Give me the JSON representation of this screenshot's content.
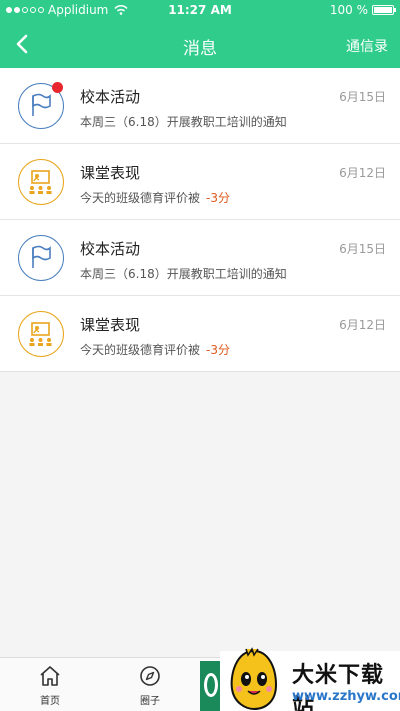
{
  "status_bar": {
    "carrier": "Applidium",
    "time": "11:27 AM",
    "battery": "100 %"
  },
  "nav": {
    "title": "消息",
    "right_action": "通信录"
  },
  "messages": [
    {
      "title": "校本活动",
      "date": "6月15日",
      "desc": "本周三（6.18）开展教职工培训的通知",
      "score": "",
      "icon": "flag-icon",
      "unread": true
    },
    {
      "title": "课堂表现",
      "date": "6月12日",
      "desc": "今天的班级德育评价被",
      "score": "-3分",
      "icon": "classroom-icon",
      "unread": false
    },
    {
      "title": "校本活动",
      "date": "6月15日",
      "desc": "本周三（6.18）开展教职工培训的通知",
      "score": "",
      "icon": "flag-icon",
      "unread": false
    },
    {
      "title": "课堂表现",
      "date": "6月12日",
      "desc": "今天的班级德育评价被",
      "score": "-3分",
      "icon": "classroom-icon",
      "unread": false
    }
  ],
  "tabbar": {
    "home": "首页",
    "circle": "圈子"
  },
  "watermark": {
    "title": "大米下载站",
    "url": "www.zzhyw.com"
  },
  "colors": {
    "primary": "#2fcc8b",
    "unread_dot": "#e8262f",
    "score": "#e05a1f",
    "flag_icon": "#4a7fbf",
    "classroom_icon": "#e9a51c"
  }
}
